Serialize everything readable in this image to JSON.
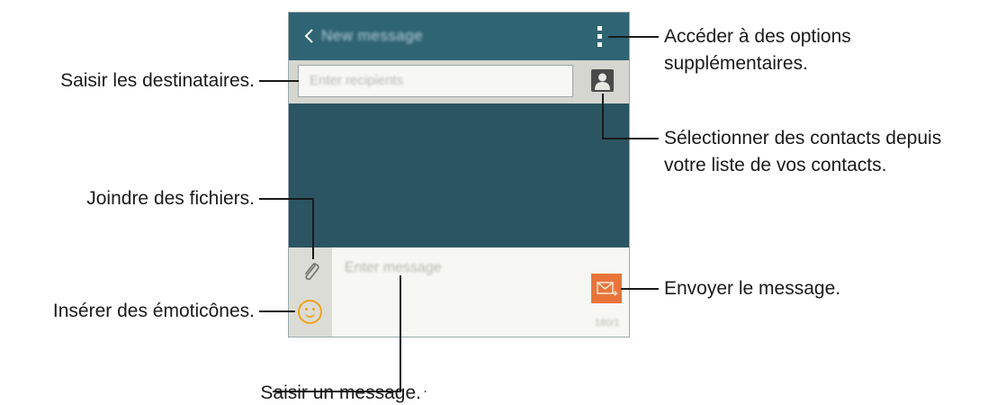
{
  "screen": {
    "action_bar": {
      "title": "New message",
      "back_icon": "chevron-left-icon",
      "menu_icon": "more-vertical-icon"
    },
    "recipient": {
      "placeholder": "Enter recipients",
      "contact_icon": "contact-person-icon"
    },
    "composer": {
      "placeholder": "Enter message",
      "attach_icon": "paperclip-icon",
      "emoji_icon": "smiley-icon",
      "send_icon": "send-envelope-icon",
      "counter": "160/1"
    }
  },
  "callouts": {
    "recipients": "Saisir les destinataires.",
    "attach": "Joindre des fichiers.",
    "emoticons": "Insérer des émoticônes.",
    "message": "Saisir un message.",
    "options_line1": "Accéder à des options",
    "options_line2": "supplémentaires.",
    "contacts_line1": "Sélectionner des contacts depuis",
    "contacts_line2": "votre liste de vos contacts.",
    "send": "Envoyer le message."
  },
  "colors": {
    "action_bar": "#2f6473",
    "conversation_bg": "#2b5562",
    "recipient_bar": "#d6d6d0",
    "composer_bg": "#f7f7f3",
    "send_button": "#e9743a",
    "emoji": "#f0a21a"
  }
}
